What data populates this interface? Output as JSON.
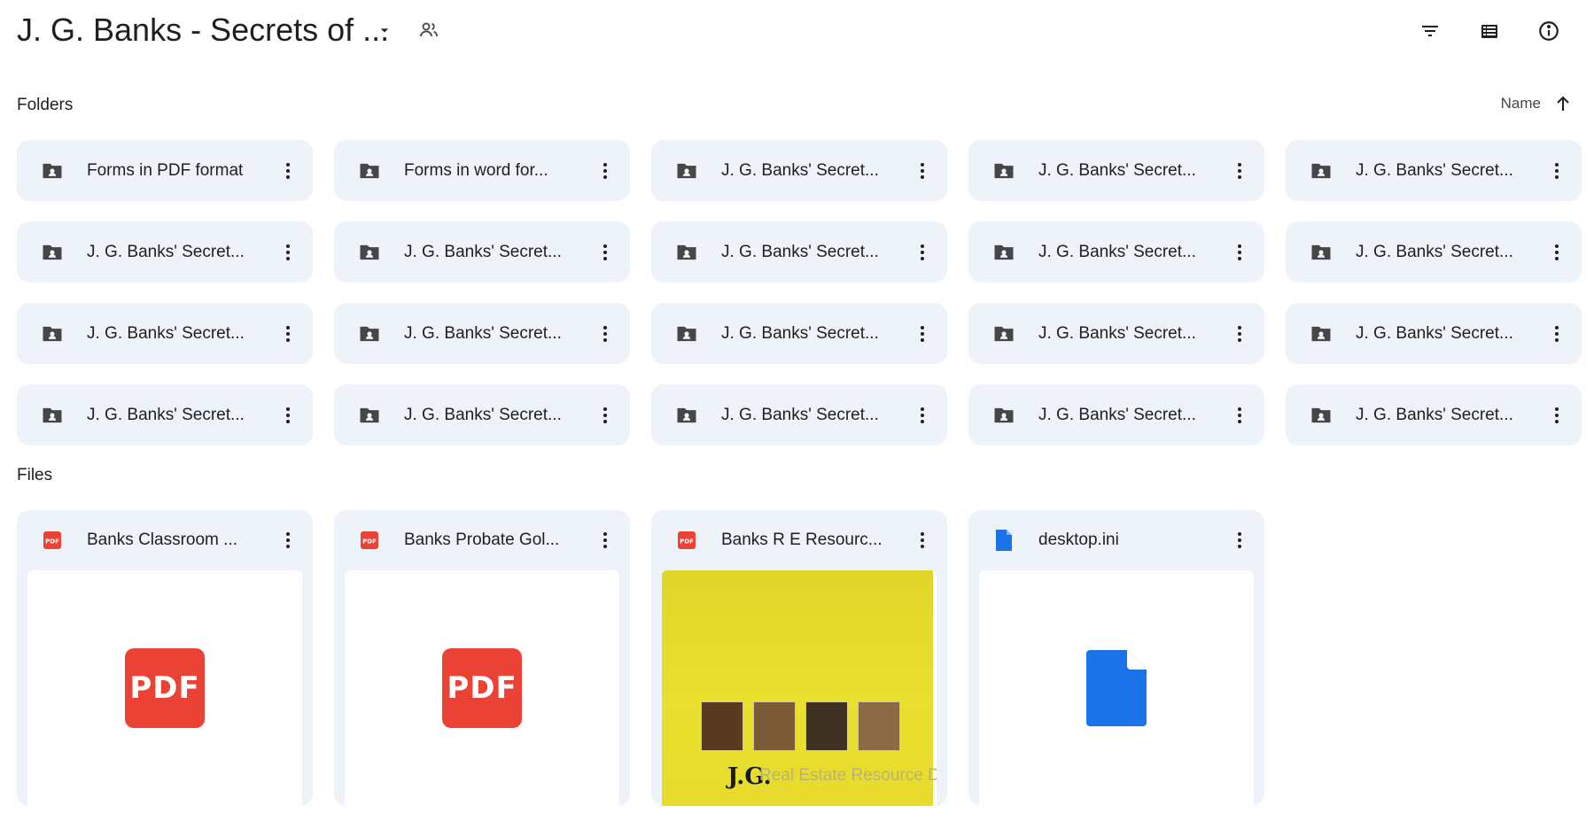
{
  "header": {
    "title": "J. G. Banks - Secrets of ...",
    "dropdown_icon": "caret-down-icon",
    "shared_icon": "people-icon",
    "actions": [
      {
        "name": "filter",
        "icon": "filter-icon"
      },
      {
        "name": "list-view",
        "icon": "list-view-icon"
      },
      {
        "name": "details",
        "icon": "info-icon"
      }
    ]
  },
  "sections": {
    "folders_label": "Folders",
    "files_label": "Files"
  },
  "sort": {
    "label": "Name",
    "direction_icon": "arrow-up-icon"
  },
  "folders": [
    {
      "name": "Forms in PDF format"
    },
    {
      "name": "Forms in word for..."
    },
    {
      "name": "J. G. Banks' Secret..."
    },
    {
      "name": "J. G. Banks' Secret..."
    },
    {
      "name": "J. G. Banks' Secret..."
    },
    {
      "name": "J. G. Banks' Secret..."
    },
    {
      "name": "J. G. Banks' Secret..."
    },
    {
      "name": "J. G. Banks' Secret..."
    },
    {
      "name": "J. G. Banks' Secret..."
    },
    {
      "name": "J. G. Banks' Secret..."
    },
    {
      "name": "J. G. Banks' Secret..."
    },
    {
      "name": "J. G. Banks' Secret..."
    },
    {
      "name": "J. G. Banks' Secret..."
    },
    {
      "name": "J. G. Banks' Secret..."
    },
    {
      "name": "J. G. Banks' Secret..."
    },
    {
      "name": "J. G. Banks' Secret..."
    },
    {
      "name": "J. G. Banks' Secret..."
    },
    {
      "name": "J. G. Banks' Secret..."
    },
    {
      "name": "J. G. Banks' Secret..."
    },
    {
      "name": "J. G. Banks' Secret..."
    }
  ],
  "files": [
    {
      "name": "Banks Classroom ...",
      "type": "pdf",
      "preview": "pdf-icon",
      "preview_text": "PDF"
    },
    {
      "name": "Banks Probate Gol...",
      "type": "pdf",
      "preview": "pdf-icon",
      "preview_text": "PDF"
    },
    {
      "name": "Banks R E Resourc...",
      "type": "pdf",
      "preview": "thumbnail",
      "thumb_brand": "J.G.",
      "thumb_title": "Real Estate Resource Directory"
    },
    {
      "name": "desktop.ini",
      "type": "file",
      "preview": "doc-icon"
    }
  ],
  "colors": {
    "card_bg": "#eef2f9",
    "pdf_red": "#ea4335",
    "file_blue": "#1a73e8",
    "icon_gray": "#444746"
  }
}
